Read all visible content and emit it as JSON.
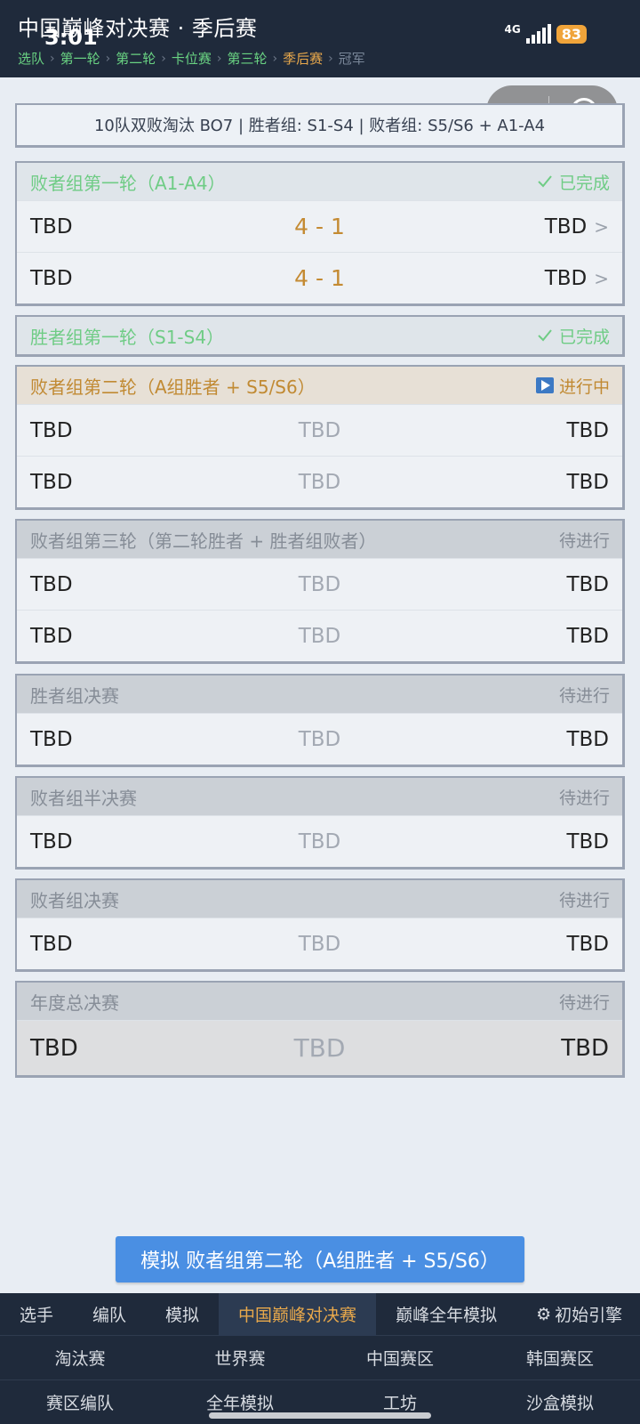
{
  "header": {
    "title": "中国巅峰对决赛 · 季后赛",
    "time": "3:01",
    "network": "4G",
    "battery": "83",
    "breadcrumbs": [
      {
        "label": "选队",
        "state": "done"
      },
      {
        "label": "第一轮",
        "state": "done"
      },
      {
        "label": "第二轮",
        "state": "done"
      },
      {
        "label": "卡位赛",
        "state": "done"
      },
      {
        "label": "第三轮",
        "state": "done"
      },
      {
        "label": "季后赛",
        "state": "active"
      },
      {
        "label": "冠军",
        "state": "pending"
      }
    ],
    "crumb_sep": "›"
  },
  "capsule": {
    "more": "•••"
  },
  "format_line": "10队双败淘汰 BO7 | 胜者组: S1-S4 | 败者组: S5/S6 + A1-A4",
  "stages": [
    {
      "title": "败者组第一轮（A1-A4）",
      "status": "已完成",
      "state": "done",
      "matches": [
        {
          "team1": "TBD",
          "mid": "4 - 1",
          "team2": "TBD",
          "chev": ">"
        },
        {
          "team1": "TBD",
          "mid": "4 - 1",
          "team2": "TBD",
          "chev": ">"
        }
      ]
    },
    {
      "title": "胜者组第一轮（S1-S4）",
      "status": "已完成",
      "state": "done",
      "matches": []
    },
    {
      "title": "败者组第二轮（A组胜者 + S5/S6）",
      "status": "进行中",
      "state": "live",
      "matches": [
        {
          "team1": "TBD",
          "mid": "TBD",
          "team2": "TBD"
        },
        {
          "team1": "TBD",
          "mid": "TBD",
          "team2": "TBD"
        }
      ]
    },
    {
      "title": "败者组第三轮（第二轮胜者 + 胜者组败者）",
      "status": "待进行",
      "state": "wait",
      "matches": [
        {
          "team1": "TBD",
          "mid": "TBD",
          "team2": "TBD"
        },
        {
          "team1": "TBD",
          "mid": "TBD",
          "team2": "TBD"
        }
      ]
    },
    {
      "title": "胜者组决赛",
      "status": "待进行",
      "state": "wait",
      "matches": [
        {
          "team1": "TBD",
          "mid": "TBD",
          "team2": "TBD"
        }
      ]
    },
    {
      "title": "败者组半决赛",
      "status": "待进行",
      "state": "wait",
      "matches": [
        {
          "team1": "TBD",
          "mid": "TBD",
          "team2": "TBD"
        }
      ]
    },
    {
      "title": "败者组决赛",
      "status": "待进行",
      "state": "wait",
      "matches": [
        {
          "team1": "TBD",
          "mid": "TBD",
          "team2": "TBD"
        }
      ]
    },
    {
      "title": "年度总决赛",
      "status": "待进行",
      "state": "wait",
      "matches": [
        {
          "team1": "TBD",
          "mid": "TBD",
          "team2": "TBD"
        }
      ]
    }
  ],
  "simulate_button": "模拟  败者组第二轮（A组胜者 + S5/S6）",
  "nav": {
    "tabs": [
      "选手",
      "编队",
      "模拟",
      "中国巅峰对决赛",
      "巅峰全年模拟",
      "初始引擎"
    ],
    "active_tab": 3,
    "row1": [
      "淘汰赛",
      "世界赛",
      "中国赛区",
      "韩国赛区"
    ],
    "row2": [
      "赛区编队",
      "全年模拟",
      "工坊",
      "沙盒模拟"
    ]
  },
  "colors": {
    "header_bg": "#1f2a3b",
    "done": "#6fcc85",
    "live": "#c18a33",
    "wait": "#868d97",
    "accent": "#4a8fe3",
    "active_tab": "#e8a84b"
  },
  "icons": {
    "done": "check-icon",
    "live": "play-icon",
    "nav_gear": "gear-icon",
    "capsule_more": "more-dots-icon",
    "capsule_close": "target-icon"
  }
}
